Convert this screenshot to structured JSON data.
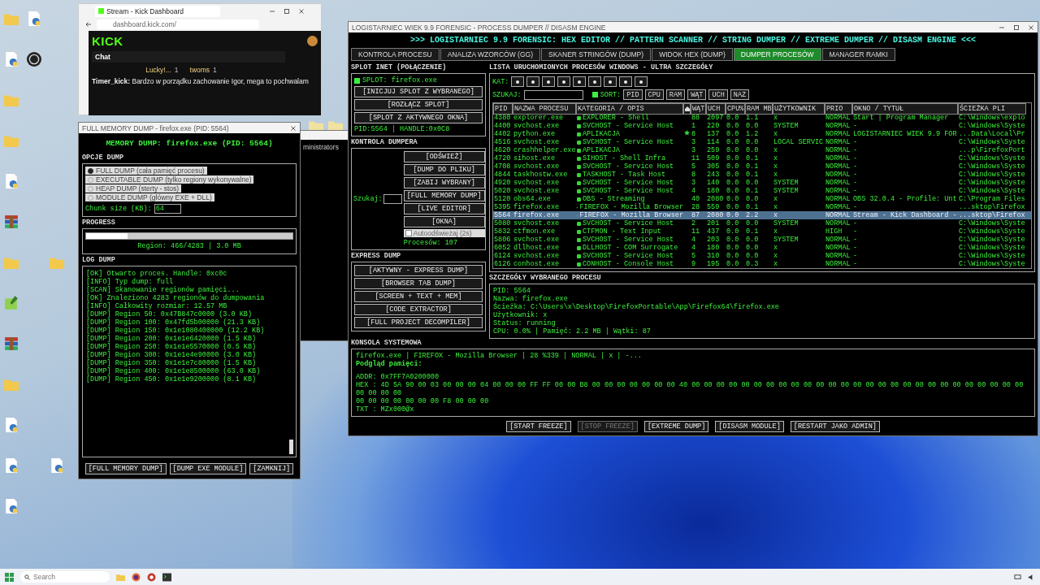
{
  "desktop": {
    "icon_columns": [
      [
        {
          "kind": "folder"
        },
        {
          "kind": "python"
        },
        {
          "kind": "folder"
        },
        {
          "kind": "folder"
        },
        {
          "kind": "python"
        },
        {
          "kind": "archive"
        },
        {
          "kind": "folder"
        },
        {
          "kind": "image"
        },
        {
          "kind": "archive"
        },
        {
          "kind": "folder"
        },
        {
          "kind": "python"
        },
        {
          "kind": "python"
        },
        {
          "kind": "python"
        }
      ],
      [
        {
          "kind": "python"
        },
        {
          "kind": "obs"
        }
      ],
      [
        {
          "kind": "blank"
        },
        {
          "kind": "blank"
        },
        {
          "kind": "blank"
        },
        {
          "kind": "blank"
        },
        {
          "kind": "blank"
        },
        {
          "kind": "blank"
        },
        {
          "kind": "folder"
        },
        {
          "kind": "blank"
        },
        {
          "kind": "blank"
        },
        {
          "kind": "blank"
        },
        {
          "kind": "blank"
        },
        {
          "kind": "python"
        }
      ]
    ],
    "loose_icons": [
      {
        "kind": "folder"
      },
      {
        "kind": "folder"
      }
    ]
  },
  "browser": {
    "tab_title": "Stream - Kick Dashboard",
    "url": "dashboard.kick.com/",
    "logo": "KICK",
    "chat_title": "Chat",
    "viewers": [
      {
        "name": "Lucky!...",
        "count": "1"
      },
      {
        "name": "twoms",
        "count": "1"
      }
    ],
    "message": "**Timer_kick:** Bardzo w porządku zachowanie Igor, mega to pochwalam"
  },
  "terminal": {
    "title_text": "ministrators"
  },
  "dump_window": {
    "title": "FULL MEMORY DUMP - firefox.exe (PID: 5564)",
    "heading": "MEMORY DUMP: firefox.exe (PID: 5564)",
    "options_label": "OPCJE DUMP",
    "options": [
      {
        "label": "FULL DUMP (cała pamięć procesu)",
        "selected": true
      },
      {
        "label": "EXECUTABLE DUMP (tylko regiony wykonywalne)",
        "selected": false
      },
      {
        "label": "HEAP DUMP (sterty - stos)",
        "selected": false
      },
      {
        "label": "MODULE DUMP (główny EXE + DLL)",
        "selected": false
      }
    ],
    "chunk_label": "Chunk size (KB):",
    "chunk_value": "64",
    "progress_label": "PROGRESS",
    "progress": {
      "level": 0.2,
      "reading": "Region: 466/4283 | 3.0 MB"
    },
    "log_label": "LOG DUMP",
    "log": [
      "[OK] Otwarto proces. Handle: 0xc0c",
      "[INFO] Typ dump: full",
      "[SCAN] Skanowanie regionów pamięci...",
      "[OK] Znaleziono 4283 regionów do dumpowania",
      "[INFO] Całkowity rozmiar: 12.57 MB",
      "[DUMP] Region 50: 0x47B847c0000 (3.0 KB)",
      "[DUMP] Region 100: 0x47fd5b00000 (21.3 KB)",
      "[DUMP] Region 150: 0x1e1080400000 (12.2 KB)",
      "[DUMP] Region 200: 0x1e1e6420000 (1.5 KB)",
      "[DUMP] Region 250: 0x1e1e5570000 (0.5 KB)",
      "[DUMP] Region 300: 0x1e1e4e90000 (3.0 KB)",
      "[DUMP] Region 350: 0x1e1e7c80000 (1.5 KB)",
      "[DUMP] Region 400: 0x1e1e8500000 (63.0 KB)",
      "[DUMP] Region 450: 0x1e1e9200000 (8.1 KB)"
    ],
    "buttons": [
      "[FULL MEMORY DUMP]",
      "[DUMP EXE MODULE]",
      "[ZAMKNIJ]"
    ]
  },
  "main_window": {
    "title": "LOGISTARNIEC WIEK 9.9 FORENSIC - PROCESS DUMPER // DISASM ENGINE",
    "heading": ">>> LOGISTARNIEC 9.9 FORENSIC: HEX EDITOR // PATTERN SCANNER // STRING DUMPER // EXTREME DUMPER // DISASM ENGINE <<<",
    "tabs": [
      {
        "label": "KONTROLA PROCESU",
        "selected": false
      },
      {
        "label": "ANALIZA WZORCÓW (GG)",
        "selected": false
      },
      {
        "label": "SKANER STRINGÓW (DUMP)",
        "selected": false
      },
      {
        "label": "WIDOK HEX (DUMP)",
        "selected": false
      },
      {
        "label": "DUMPER PROCESÓW",
        "selected": true
      },
      {
        "label": "MANAGER RAMKI",
        "selected": false
      }
    ],
    "splot": {
      "label": "SPLOT INET (POŁĄCZENIE)",
      "checkbox": {
        "label": "SPLOT: firefox.exe",
        "checked": true
      },
      "buttons": [
        "[INICJUJ SPLOT Z WYBRANEGO]",
        "[ROZŁĄCZ SPLOT]",
        "[SPLOT Z AKTYWNEGO OKNA]"
      ],
      "status": "PID:5564 | HANDLE:0x0C8"
    },
    "dumper": {
      "label": "KONTROLA DUMPERA",
      "search_label": "Szukaj:",
      "buttons": [
        "[ODŚWIEŻ]",
        "[DUMP DO PLIKU]",
        "[ZABIJ WYBRANY]",
        "[FULL MEMORY DUMP]",
        "[LIVE EDITOR]",
        "[OKNA]"
      ],
      "autorefresh": {
        "label": "Autoodświeżaj (2s)",
        "checked": false
      },
      "count": "Procesów: 107"
    },
    "express": {
      "label": "EXPRESS DUMP",
      "buttons": [
        "[AKTYWNY - EXPRESS DUMP]",
        "[BROWSER TAB DUMP]",
        "[SCREEN + TEXT + MEM]",
        "[CODE EXTRACTOR]",
        "[FULL PROJECT DECOMPILER]"
      ]
    },
    "list": {
      "label": "LISTA URUCHOMIONYCH PROCESÓW WINDOWS - ULTRA SZCZEGÓŁY",
      "category_label": "KAT:",
      "search_label": "SZUKAJ:",
      "sort": {
        "label": "SORT:",
        "checked": true
      },
      "sort_buttons": [
        "PID",
        "CPU",
        "RAM",
        "WĄT",
        "UCH",
        "NAZ"
      ],
      "columns": [
        "PID",
        "NAZWA PROCESU",
        "KATEGORIA / OPIS",
        "",
        "WĄT",
        "UCH",
        "CPU%",
        "RAM MB",
        "UŻYTKOWNIK",
        "PRIO",
        "OKNO / TYTUŁ",
        "ŚCIEŻKA PLI"
      ],
      "rows": [
        {
          "cells": [
            "4380",
            "explorer.exe",
            "EXPLORER - Shell",
            "",
            "88",
            "2097",
            "0.0",
            "1.1",
            "x",
            "NORMAL",
            "Start | Program Manager",
            "C:\\Windows\\explo"
          ],
          "starred": false,
          "selected": false
        },
        {
          "cells": [
            "4400",
            "svchost.exe",
            "SVCHOST - Service Host",
            "",
            "1",
            "220",
            "0.0",
            "0.0",
            "SYSTEM",
            "NORMAL",
            "-",
            "C:\\Windows\\Syste"
          ],
          "starred": false,
          "selected": false
        },
        {
          "cells": [
            "4402",
            "python.exe",
            "APLIKACJA",
            "",
            "8",
            "137",
            "0.0",
            "1.2",
            "x",
            "NORMAL",
            "LOGISTARNIEC WIEK 9.9 FOR",
            "...Data\\Local\\Pr"
          ],
          "starred": true,
          "selected": false
        },
        {
          "cells": [
            "4516",
            "svchost.exe",
            "SVCHOST - Service Host",
            "",
            "3",
            "114",
            "0.0",
            "0.0",
            "LOCAL SERVIC",
            "NORMAL",
            "-",
            "C:\\Windows\\Syste"
          ],
          "starred": false,
          "selected": false
        },
        {
          "cells": [
            "4620",
            "crashhelper.exe",
            "APLIKACJA",
            "",
            "3",
            "259",
            "0.0",
            "0.0",
            "x",
            "NORMAL",
            "-",
            "...p\\FirefoxPort"
          ],
          "starred": false,
          "selected": false
        },
        {
          "cells": [
            "4720",
            "sihost.exe",
            "SIHOST - Shell Infra",
            "",
            "11",
            "509",
            "0.0",
            "0.1",
            "x",
            "NORMAL",
            "-",
            "C:\\Windows\\Syste"
          ],
          "starred": false,
          "selected": false
        },
        {
          "cells": [
            "4708",
            "svchost.exe",
            "SVCHOST - Service Host",
            "",
            "5",
            "305",
            "0.0",
            "0.1",
            "x",
            "NORMAL",
            "-",
            "C:\\Windows\\Syste"
          ],
          "starred": false,
          "selected": false
        },
        {
          "cells": [
            "4844",
            "taskhostw.exe",
            "TASKHOST - Task Host",
            "",
            "8",
            "243",
            "0.0",
            "0.1",
            "x",
            "NORMAL",
            "-",
            "C:\\Windows\\Syste"
          ],
          "starred": false,
          "selected": false
        },
        {
          "cells": [
            "4920",
            "svchost.exe",
            "SVCHOST - Service Host",
            "",
            "3",
            "140",
            "0.0",
            "0.0",
            "SYSTEM",
            "NORMAL",
            "-",
            "C:\\Windows\\Syste"
          ],
          "starred": false,
          "selected": false
        },
        {
          "cells": [
            "5020",
            "svchost.exe",
            "SVCHOST - Service Host",
            "",
            "4",
            "180",
            "0.0",
            "0.1",
            "SYSTEM",
            "NORMAL",
            "-",
            "C:\\Windows\\Syste"
          ],
          "starred": false,
          "selected": false
        },
        {
          "cells": [
            "5120",
            "obs64.exe",
            "OBS - Streaming",
            "",
            "40",
            "2080",
            "0.0",
            "0.0",
            "x",
            "NORMAL",
            "OBS 32.0.4 - Profile: Unt",
            "C:\\Program Files"
          ],
          "starred": false,
          "selected": false
        },
        {
          "cells": [
            "5395",
            "firefox.exe",
            "FIREFOX - Mozilla Browser",
            "",
            "28",
            "559",
            "0.0",
            "0.1",
            "x",
            "NORMAL",
            "-",
            "...sktop\\Firefox"
          ],
          "starred": false,
          "selected": false
        },
        {
          "cells": [
            "5564",
            "firefox.exe",
            "FIREFOX - Mozilla Browser",
            "",
            "87",
            "2080",
            "0.0",
            "2.2",
            "x",
            "NORMAL",
            "Stream - Kick Dashboard -",
            "...sktop\\Firefox"
          ],
          "starred": false,
          "selected": true
        },
        {
          "cells": [
            "5080",
            "svchost.exe",
            "SVCHOST - Service Host",
            "",
            "2",
            "201",
            "0.0",
            "0.0",
            "SYSTEM",
            "NORMAL",
            "-",
            "C:\\Windows\\Syste"
          ],
          "starred": false,
          "selected": false
        },
        {
          "cells": [
            "5832",
            "ctfmon.exe",
            "CTFMON - Text Input",
            "",
            "11",
            "437",
            "0.0",
            "0.1",
            "x",
            "HIGH",
            "-",
            "C:\\Windows\\Syste"
          ],
          "starred": false,
          "selected": false
        },
        {
          "cells": [
            "5806",
            "svchost.exe",
            "SVCHOST - Service Host",
            "",
            "4",
            "203",
            "0.0",
            "0.0",
            "SYSTEM",
            "NORMAL",
            "-",
            "C:\\Windows\\Syste"
          ],
          "starred": false,
          "selected": false
        },
        {
          "cells": [
            "6052",
            "dllhost.exe",
            "DLLHOST - COM Surrogate",
            "",
            "4",
            "180",
            "0.0",
            "0.0",
            "x",
            "NORMAL",
            "-",
            "C:\\Windows\\Syste"
          ],
          "starred": false,
          "selected": false
        },
        {
          "cells": [
            "6124",
            "svchost.exe",
            "SVCHOST - Service Host",
            "",
            "5",
            "310",
            "0.0",
            "0.0",
            "x",
            "NORMAL",
            "-",
            "C:\\Windows\\Syste"
          ],
          "starred": false,
          "selected": false
        },
        {
          "cells": [
            "6126",
            "conhost.exe",
            "CONHOST - Console Host",
            "",
            "9",
            "195",
            "0.0",
            "0.3",
            "x",
            "NORMAL",
            "-",
            "C:\\Windows\\Syste"
          ],
          "starred": false,
          "selected": false
        }
      ]
    },
    "details": {
      "label": "SZCZEGÓŁY WYBRANEGO PROCESU",
      "lines": [
        "PID: 5564",
        "Nazwa: firefox.exe",
        "Ścieżka: C:\\Users\\x\\Desktop\\FirefoxPortable\\App\\Firefox64\\firefox.exe",
        "Użytkownik: x",
        "Status: running",
        "CPU: 0.0% | Pamięć: 2.2 MB | Wątki: 87"
      ]
    },
    "console": {
      "label": "KONSOLA SYSTEMOWA",
      "lines": [
        {
          "kind": "summary",
          "text": "firefox.exe | FIREFOX - Mozilla Browser | 28 %339 | NORMAL | x | -..."
        },
        {
          "kind": "heading",
          "text": "Podgląd pamięci:"
        },
        {
          "kind": "memory",
          "text": "ADDR: 0x7FF7A0200000"
        },
        {
          "kind": "memory",
          "text": "HEX : 4D 5A 90 00 03 00 00 00 04 00 00 00 FF FF 00 00 B8 00 00 00 00 00 00 00 40 00 00 00 00 00 00 00 00 00 00 00 00 00 00 00 00 00 00 00 00 00 00 00 00 00 00 00 00 00 00 00"
        },
        {
          "kind": "memory",
          "text": "00 00 00 00 00 00 00 F8 00 00 00"
        },
        {
          "kind": "memory",
          "text": "TXT : MZx000@x"
        }
      ]
    },
    "bottom_buttons": [
      {
        "label": "[START FREEZE]",
        "disabled": false
      },
      {
        "label": "[STOP FREEZE]",
        "disabled": true
      },
      {
        "label": "[EXTREME DUMP]",
        "disabled": false
      },
      {
        "label": "[DISASM MODULE]",
        "disabled": false
      },
      {
        "label": "[RESTART JAKO ADMIN]",
        "disabled": false
      }
    ]
  },
  "taskbar": {
    "search_placeholder": "Search"
  }
}
